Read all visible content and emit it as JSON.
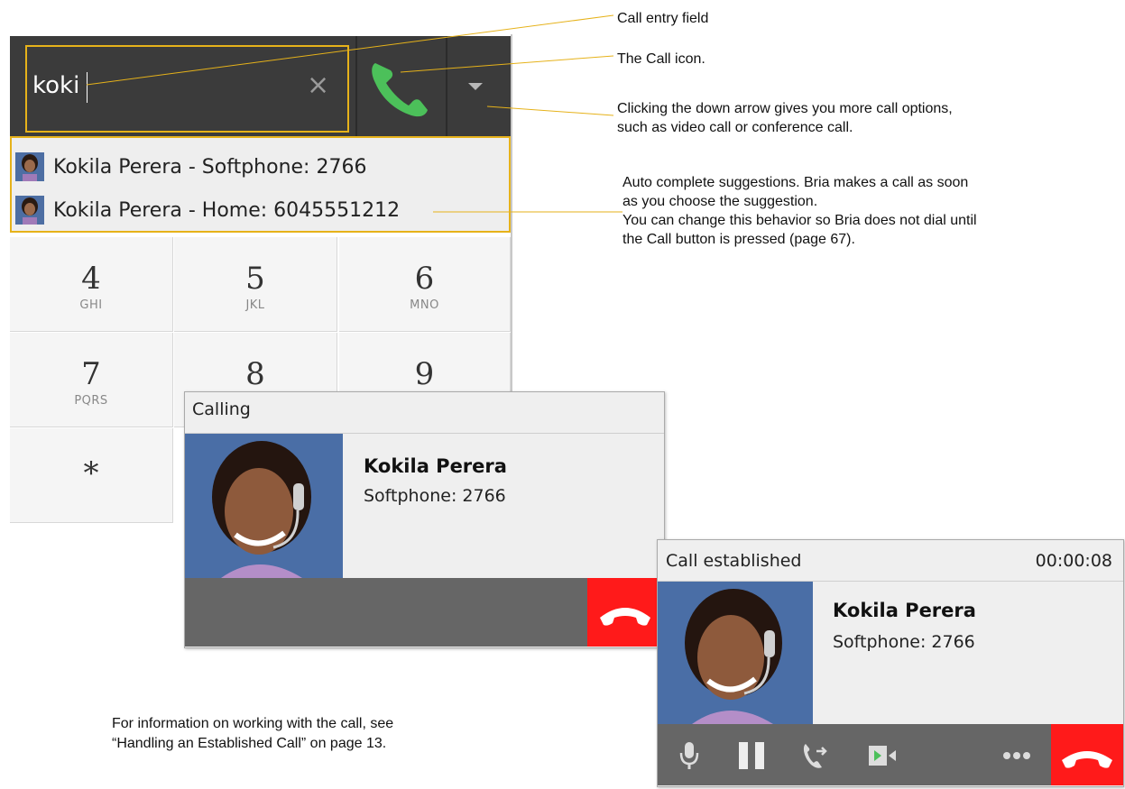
{
  "dialer": {
    "entry_value": "koki",
    "clear_icon": "close-icon",
    "call_icon": "phone-icon",
    "arrow_icon": "chevron-down-icon",
    "accent": "#e6b21a",
    "call_green": "#4cc05a",
    "suggestions": [
      {
        "label": "Kokila Perera - Softphone: 2766"
      },
      {
        "label": "Kokila Perera - Home: 6045551212"
      }
    ],
    "keys": [
      {
        "digit": "4",
        "letters": "GHI"
      },
      {
        "digit": "5",
        "letters": "JKL"
      },
      {
        "digit": "6",
        "letters": "MNO"
      },
      {
        "digit": "7",
        "letters": "PQRS"
      },
      {
        "digit": "8",
        "letters": ""
      },
      {
        "digit": "9",
        "letters": ""
      },
      {
        "digit": "*",
        "letters": ""
      }
    ]
  },
  "calling_popup": {
    "title": "Calling",
    "name": "Kokila Perera",
    "detail": "Softphone: 2766",
    "hangup_color": "#ff1a1a"
  },
  "established_popup": {
    "title": "Call established",
    "timer": "00:00:08",
    "name": "Kokila Perera",
    "detail": "Softphone: 2766",
    "controls": [
      "microphone-icon",
      "pause-icon",
      "transfer-icon",
      "video-icon",
      "more-icon",
      "hangup-icon"
    ]
  },
  "callouts": {
    "entry_field": "Call entry field",
    "call_icon": "The Call icon.",
    "down_arrow_line1": "Clicking the down arrow gives you more call options,",
    "down_arrow_line2": "such as video call or conference call.",
    "auto_line1": "Auto complete suggestions. Bria makes a call as soon",
    "auto_line2": "as you choose the suggestion.",
    "auto_line3": "You can change this behavior so Bria does not dial until",
    "auto_line4": "the Call button is pressed (page 67)."
  },
  "note": {
    "line1": "For information on working with the call, see",
    "line2": "“Handling an Established Call” on page 13."
  }
}
